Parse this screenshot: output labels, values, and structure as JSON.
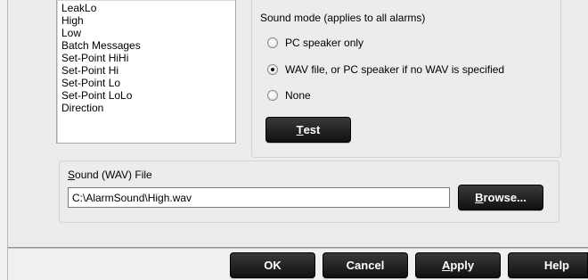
{
  "alarm_list": {
    "items": [
      "LeakLo",
      "High",
      "Low",
      "Batch Messages",
      "Set-Point HiHi",
      "Set-Point Hi",
      "Set-Point Lo",
      "Set-Point LoLo",
      "Direction"
    ]
  },
  "sound_mode": {
    "label": "Sound mode (applies to all alarms)",
    "options": [
      {
        "label": "PC speaker only",
        "checked": false
      },
      {
        "label": "WAV file, or PC speaker if no WAV is specified",
        "checked": true
      },
      {
        "label": "None",
        "checked": false
      }
    ],
    "test_mnemonic": "T",
    "test_rest": "est"
  },
  "sound_file": {
    "label_mnemonic": "S",
    "label_rest": "ound (WAV) File",
    "value": "C:\\AlarmSound\\High.wav",
    "browse_mnemonic": "B",
    "browse_rest": "rowse..."
  },
  "footer": {
    "ok": "OK",
    "cancel": "Cancel",
    "apply_mnemonic": "A",
    "apply_rest": "pply",
    "help": "Help"
  }
}
